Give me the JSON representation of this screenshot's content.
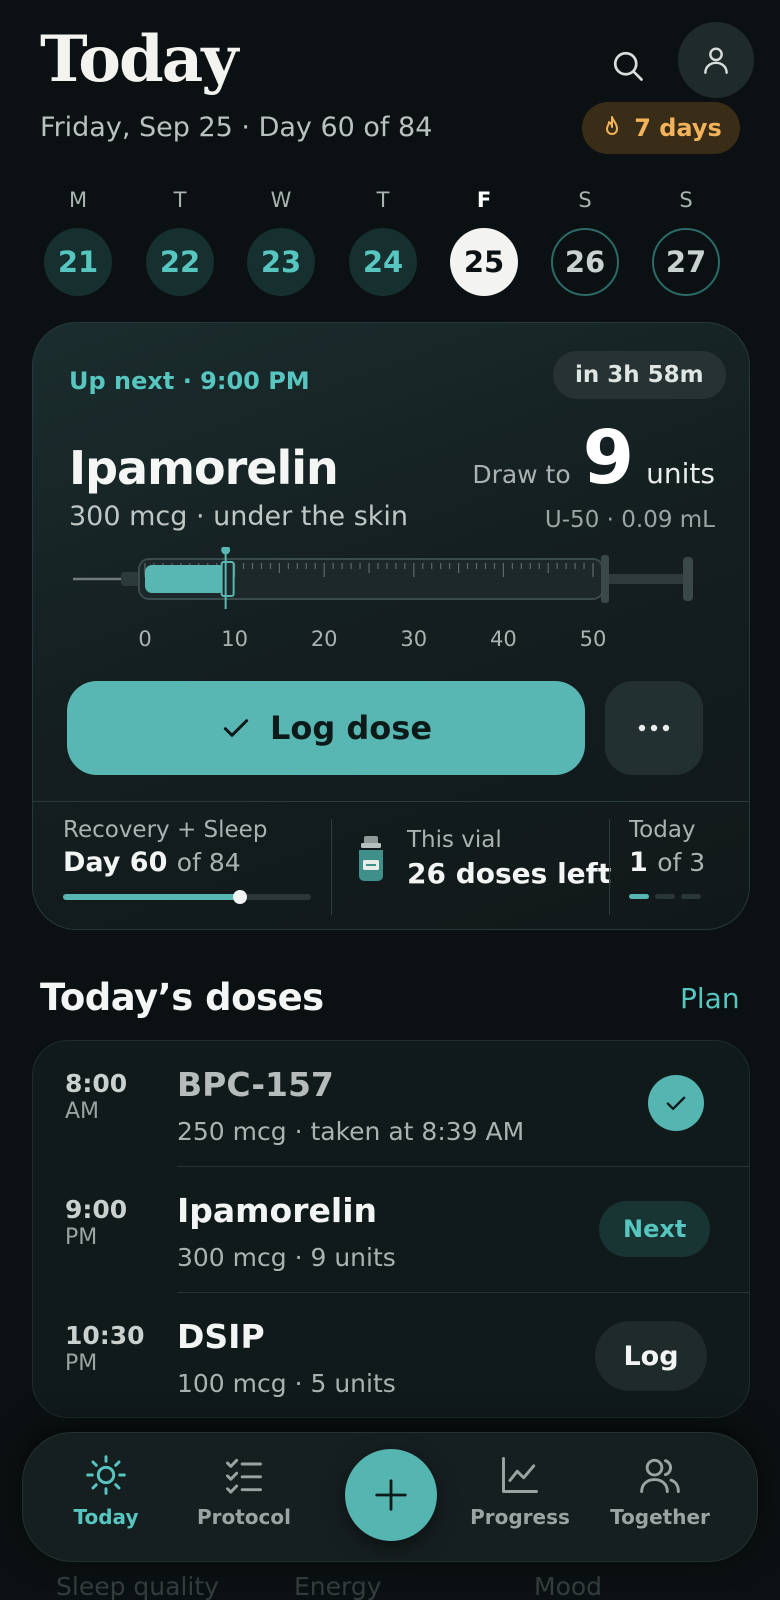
{
  "header": {
    "title": "Today",
    "subtitle": "Friday, Sep 25 · Day 60 of 84",
    "streak": "7 days",
    "icons": [
      "search-icon",
      "user-icon",
      "flame-icon"
    ],
    "accent": "#57c6c0",
    "streak_color": "#f2b35a"
  },
  "week": [
    {
      "weekday": "M",
      "date": "21",
      "state": "past"
    },
    {
      "weekday": "T",
      "date": "22",
      "state": "past"
    },
    {
      "weekday": "W",
      "date": "23",
      "state": "past"
    },
    {
      "weekday": "T",
      "date": "24",
      "state": "past"
    },
    {
      "weekday": "F",
      "date": "25",
      "state": "today"
    },
    {
      "weekday": "S",
      "date": "26",
      "state": "future"
    },
    {
      "weekday": "S",
      "date": "27",
      "state": "future"
    }
  ],
  "next_dose": {
    "label": "Up next · 9:00 PM",
    "countdown": "in 3h 58m",
    "name": "Ipamorelin",
    "detail": "300 mcg · under the skin",
    "draw_to_label": "Draw to",
    "units_value": "9",
    "units_label": "units",
    "syringe_spec": "U-50 · 0.09 mL",
    "syringe_fill_units": 9,
    "syringe_max_units": 50,
    "syringe_ticks": [
      "0",
      "10",
      "20",
      "30",
      "40",
      "50"
    ],
    "log_label": "Log dose",
    "more_icon": "more-horizontal-icon"
  },
  "stats": {
    "protocol": {
      "label": "Recovery + Sleep",
      "day_prefix": "Day 60",
      "day_suffix": "of 84",
      "progress": 0.714
    },
    "vial": {
      "label": "This vial",
      "value": "26 doses left",
      "icon": "vial-icon"
    },
    "today": {
      "label": "Today",
      "count": "1",
      "suffix": "of 3",
      "done": 1,
      "total": 3
    }
  },
  "doses_section": {
    "title": "Today’s doses",
    "plan_link": "Plan",
    "rows": [
      {
        "time": "8:00",
        "ampm": "AM",
        "name": "BPC-157",
        "detail": "250 mcg · taken at 8:39 AM",
        "status": "done"
      },
      {
        "time": "9:00",
        "ampm": "PM",
        "name": "Ipamorelin",
        "detail": "300 mcg · 9 units",
        "status": "next",
        "action": "Next"
      },
      {
        "time": "10:30",
        "ampm": "PM",
        "name": "DSIP",
        "detail": "100 mcg · 5 units",
        "status": "pending",
        "action": "Log"
      }
    ]
  },
  "peek_labels": [
    "Sleep quality",
    "Energy",
    "Mood"
  ],
  "tabbar": {
    "tabs": [
      {
        "label": "Today",
        "icon": "sun-icon",
        "active": true
      },
      {
        "label": "Protocol",
        "icon": "checklist-icon",
        "active": false
      },
      {
        "label": "Progress",
        "icon": "chart-icon",
        "active": false
      },
      {
        "label": "Together",
        "icon": "users-icon",
        "active": false
      }
    ],
    "fab_icon": "plus-icon"
  }
}
